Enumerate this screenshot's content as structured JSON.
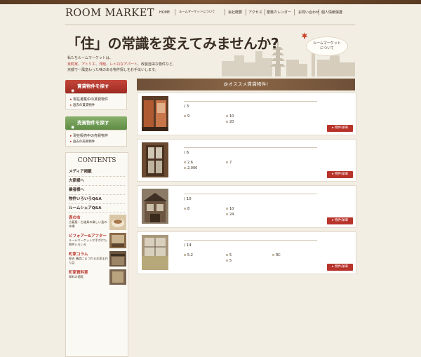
{
  "header": {
    "logo": "ROOM MARKET",
    "nav": [
      "HOME",
      "ルームマーケットについて",
      "会社概要",
      "アクセス",
      "業務カレンダー",
      "お問い合わせ",
      "個人情報保護"
    ]
  },
  "hero": {
    "title": "「住」の常識を変えてみませんか?",
    "text_line1": "私たちルームマーケットは、",
    "text_line2_parts": [
      "京町家",
      "、",
      "アトリエ",
      "、",
      "洋館",
      "、",
      "レトロなアパート",
      "、改装自由な物件など、"
    ],
    "text_line3": "京都で一風変わった味のある物件探しをお手伝いします。",
    "badge_line1": "ルームマーケット",
    "badge_line2": "について"
  },
  "sidebar": {
    "rent_button": "賃貸物件を探す",
    "rent_current": "現在募集中の賃貸物件",
    "rent_past": "過去の賃貸物件",
    "sale_button": "売買物件を探す",
    "sale_current": "現在販売中の売買物件",
    "sale_past": "過去の売買物件",
    "contents_title": "CONTENTS",
    "menu": [
      "メディア掲載",
      "大家様へ",
      "業者様へ",
      "物件いろいろQ&A",
      "ルームシェアQ&A"
    ],
    "features": [
      {
        "title": "表の市",
        "sub": "古着屋・古道具の楽しい蚤の市場"
      },
      {
        "title": "ビフォアー&アフター",
        "sub": "ルームマーケットが手がけた物件いろいろ"
      },
      {
        "title": "町家コラム",
        "sub": "歴史 構造にまつわるお家まわり話"
      },
      {
        "title": "町家資料室",
        "sub": "資料の閲覧"
      }
    ]
  },
  "main": {
    "heading": "@オススメ賃貸物件!",
    "detail_label": "物件詳細",
    "cards": [
      {
        "yen": "/ 3",
        "f1": "9",
        "f2": "10",
        "f3": "",
        "f4": "",
        "f5": "20"
      },
      {
        "yen": "/ 6",
        "f1": "2.6",
        "f2": "7",
        "f3": "",
        "f4": "2,000",
        "f5": ""
      },
      {
        "yen": "/ 10",
        "f1": "8",
        "f2": "10",
        "f3": "",
        "f4": "",
        "f5": "24"
      },
      {
        "yen": "/ 14",
        "f1": "5.2",
        "f2": "5",
        "f3": "RC",
        "f4": "",
        "f5": "5"
      }
    ]
  },
  "colors": {
    "accent_red": "#b8332a",
    "accent_green": "#6f9a54",
    "wood": "#7a5234",
    "background": "#f2eee4"
  }
}
